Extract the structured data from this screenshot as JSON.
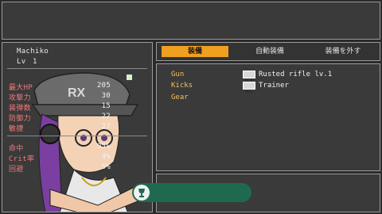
{
  "character": {
    "name": "Machiko",
    "level_label": "Lv",
    "level_value": "1"
  },
  "stats_primary": [
    {
      "label": "最大HP",
      "value": "205"
    },
    {
      "label": "攻撃力",
      "value": "30"
    },
    {
      "label": "装弾数",
      "value": "15"
    },
    {
      "label": "防御力",
      "value": "22"
    },
    {
      "label": "敏捷",
      "value": "27"
    }
  ],
  "stats_secondary": [
    {
      "label": "命中",
      "value": "95%"
    },
    {
      "label": "Crit率",
      "value": "4%"
    },
    {
      "label": "回避",
      "value": "5%"
    }
  ],
  "tabs": [
    {
      "label": "装備",
      "active": true
    },
    {
      "label": "自動装備",
      "active": false
    },
    {
      "label": "装備を外す",
      "active": false
    }
  ],
  "equipment": [
    {
      "slot": "Gun",
      "item": "Rusted rifle lv.1",
      "icon": "rifle-icon"
    },
    {
      "slot": "Kicks",
      "item": "Trainer",
      "icon": "shoe-icon"
    },
    {
      "slot": "Gear",
      "item": "",
      "icon": ""
    }
  ],
  "colors": {
    "accent_tab": "#f0a020",
    "stat_label": "#f07a7a",
    "slot_label": "#f0c060",
    "toast_bg": "#1f6a4e"
  },
  "toast": {
    "icon": "trophy-icon",
    "text": ""
  }
}
